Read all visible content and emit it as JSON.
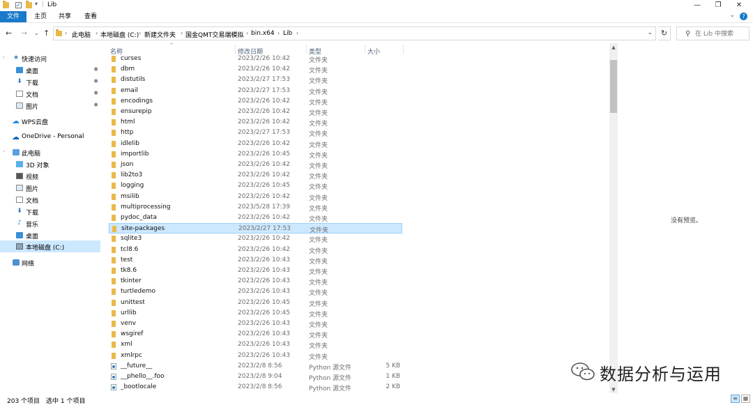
{
  "window": {
    "title": "Lib"
  },
  "ribbon": {
    "tabs": [
      "文件",
      "主页",
      "共享",
      "查看"
    ]
  },
  "address": {
    "crumbs": [
      "此电脑",
      "本地磁盘 (C:)",
      "新建文件夹",
      "国金QMT交易端模拟",
      "bin.x64",
      "Lib"
    ],
    "search_placeholder": "在 Lib 中搜索"
  },
  "sidebar": {
    "items": [
      {
        "label": "快速访问",
        "icon": "star-icon",
        "level": 0
      },
      {
        "label": "桌面",
        "icon": "desktop-icon",
        "level": 1,
        "pinned": true
      },
      {
        "label": "下载",
        "icon": "download-icon",
        "level": 1,
        "pinned": true
      },
      {
        "label": "文档",
        "icon": "document-icon",
        "level": 1,
        "pinned": true
      },
      {
        "label": "图片",
        "icon": "picture-icon",
        "level": 1,
        "pinned": true
      },
      {
        "label": "WPS云盘",
        "icon": "cloud-icon",
        "level": 0
      },
      {
        "label": "OneDrive - Personal",
        "icon": "onedrive-icon",
        "level": 0
      },
      {
        "label": "此电脑",
        "icon": "pc-icon",
        "level": 0
      },
      {
        "label": "3D 对象",
        "icon": "3d-objects-icon",
        "level": 1
      },
      {
        "label": "视频",
        "icon": "video-icon",
        "level": 1
      },
      {
        "label": "图片",
        "icon": "picture-icon",
        "level": 1
      },
      {
        "label": "文档",
        "icon": "document-icon",
        "level": 1
      },
      {
        "label": "下载",
        "icon": "download-icon",
        "level": 1
      },
      {
        "label": "音乐",
        "icon": "music-icon",
        "level": 1
      },
      {
        "label": "桌面",
        "icon": "desktop-icon",
        "level": 1
      },
      {
        "label": "本地磁盘 (C:)",
        "icon": "drive-icon",
        "level": 1,
        "selected": true
      },
      {
        "label": "网络",
        "icon": "network-icon",
        "level": 0
      }
    ]
  },
  "list": {
    "columns": {
      "name": "名称",
      "date": "修改日期",
      "type": "类型",
      "size": "大小"
    },
    "rows": [
      {
        "name": "curses",
        "date": "2023/2/26 10:42",
        "type": "文件夹",
        "size": "",
        "kind": "folder"
      },
      {
        "name": "dbm",
        "date": "2023/2/26 10:42",
        "type": "文件夹",
        "size": "",
        "kind": "folder"
      },
      {
        "name": "distutils",
        "date": "2023/2/27 17:53",
        "type": "文件夹",
        "size": "",
        "kind": "folder"
      },
      {
        "name": "email",
        "date": "2023/2/27 17:53",
        "type": "文件夹",
        "size": "",
        "kind": "folder"
      },
      {
        "name": "encodings",
        "date": "2023/2/26 10:42",
        "type": "文件夹",
        "size": "",
        "kind": "folder"
      },
      {
        "name": "ensurepip",
        "date": "2023/2/26 10:42",
        "type": "文件夹",
        "size": "",
        "kind": "folder"
      },
      {
        "name": "html",
        "date": "2023/2/26 10:42",
        "type": "文件夹",
        "size": "",
        "kind": "folder"
      },
      {
        "name": "http",
        "date": "2023/2/27 17:53",
        "type": "文件夹",
        "size": "",
        "kind": "folder"
      },
      {
        "name": "idlelib",
        "date": "2023/2/26 10:42",
        "type": "文件夹",
        "size": "",
        "kind": "folder"
      },
      {
        "name": "importlib",
        "date": "2023/2/26 10:45",
        "type": "文件夹",
        "size": "",
        "kind": "folder"
      },
      {
        "name": "json",
        "date": "2023/2/26 10:42",
        "type": "文件夹",
        "size": "",
        "kind": "folder"
      },
      {
        "name": "lib2to3",
        "date": "2023/2/26 10:42",
        "type": "文件夹",
        "size": "",
        "kind": "folder"
      },
      {
        "name": "logging",
        "date": "2023/2/26 10:45",
        "type": "文件夹",
        "size": "",
        "kind": "folder"
      },
      {
        "name": "msilib",
        "date": "2023/2/26 10:42",
        "type": "文件夹",
        "size": "",
        "kind": "folder"
      },
      {
        "name": "multiprocessing",
        "date": "2023/5/28 17:39",
        "type": "文件夹",
        "size": "",
        "kind": "folder"
      },
      {
        "name": "pydoc_data",
        "date": "2023/2/26 10:42",
        "type": "文件夹",
        "size": "",
        "kind": "folder"
      },
      {
        "name": "site-packages",
        "date": "2023/2/27 17:53",
        "type": "文件夹",
        "size": "",
        "kind": "folder",
        "selected": true
      },
      {
        "name": "sqlite3",
        "date": "2023/2/26 10:42",
        "type": "文件夹",
        "size": "",
        "kind": "folder"
      },
      {
        "name": "tcl8.6",
        "date": "2023/2/26 10:42",
        "type": "文件夹",
        "size": "",
        "kind": "folder"
      },
      {
        "name": "test",
        "date": "2023/2/26 10:43",
        "type": "文件夹",
        "size": "",
        "kind": "folder"
      },
      {
        "name": "tk8.6",
        "date": "2023/2/26 10:43",
        "type": "文件夹",
        "size": "",
        "kind": "folder"
      },
      {
        "name": "tkinter",
        "date": "2023/2/26 10:43",
        "type": "文件夹",
        "size": "",
        "kind": "folder"
      },
      {
        "name": "turtledemo",
        "date": "2023/2/26 10:43",
        "type": "文件夹",
        "size": "",
        "kind": "folder"
      },
      {
        "name": "unittest",
        "date": "2023/2/26 10:45",
        "type": "文件夹",
        "size": "",
        "kind": "folder"
      },
      {
        "name": "urllib",
        "date": "2023/2/26 10:45",
        "type": "文件夹",
        "size": "",
        "kind": "folder"
      },
      {
        "name": "venv",
        "date": "2023/2/26 10:43",
        "type": "文件夹",
        "size": "",
        "kind": "folder"
      },
      {
        "name": "wsgiref",
        "date": "2023/2/26 10:43",
        "type": "文件夹",
        "size": "",
        "kind": "folder"
      },
      {
        "name": "xml",
        "date": "2023/2/26 10:43",
        "type": "文件夹",
        "size": "",
        "kind": "folder"
      },
      {
        "name": "xmlrpc",
        "date": "2023/2/26 10:43",
        "type": "文件夹",
        "size": "",
        "kind": "folder"
      },
      {
        "name": "__future__",
        "date": "2023/2/8 8:56",
        "type": "Python 源文件",
        "size": "5 KB",
        "kind": "file"
      },
      {
        "name": "__phello__.foo",
        "date": "2023/2/8 9:04",
        "type": "Python 源文件",
        "size": "1 KB",
        "kind": "file"
      },
      {
        "name": "_bootlocale",
        "date": "2023/2/8 8:56",
        "type": "Python 源文件",
        "size": "2 KB",
        "kind": "file"
      }
    ]
  },
  "preview": {
    "empty_text": "没有预览。"
  },
  "status": {
    "item_count": "203 个项目",
    "selection": "选中 1 个项目"
  },
  "watermark": {
    "text": "数据分析与运用"
  },
  "colors": {
    "accent": "#1979ca",
    "selection": "#cce8ff",
    "folder": "#e9b949"
  }
}
